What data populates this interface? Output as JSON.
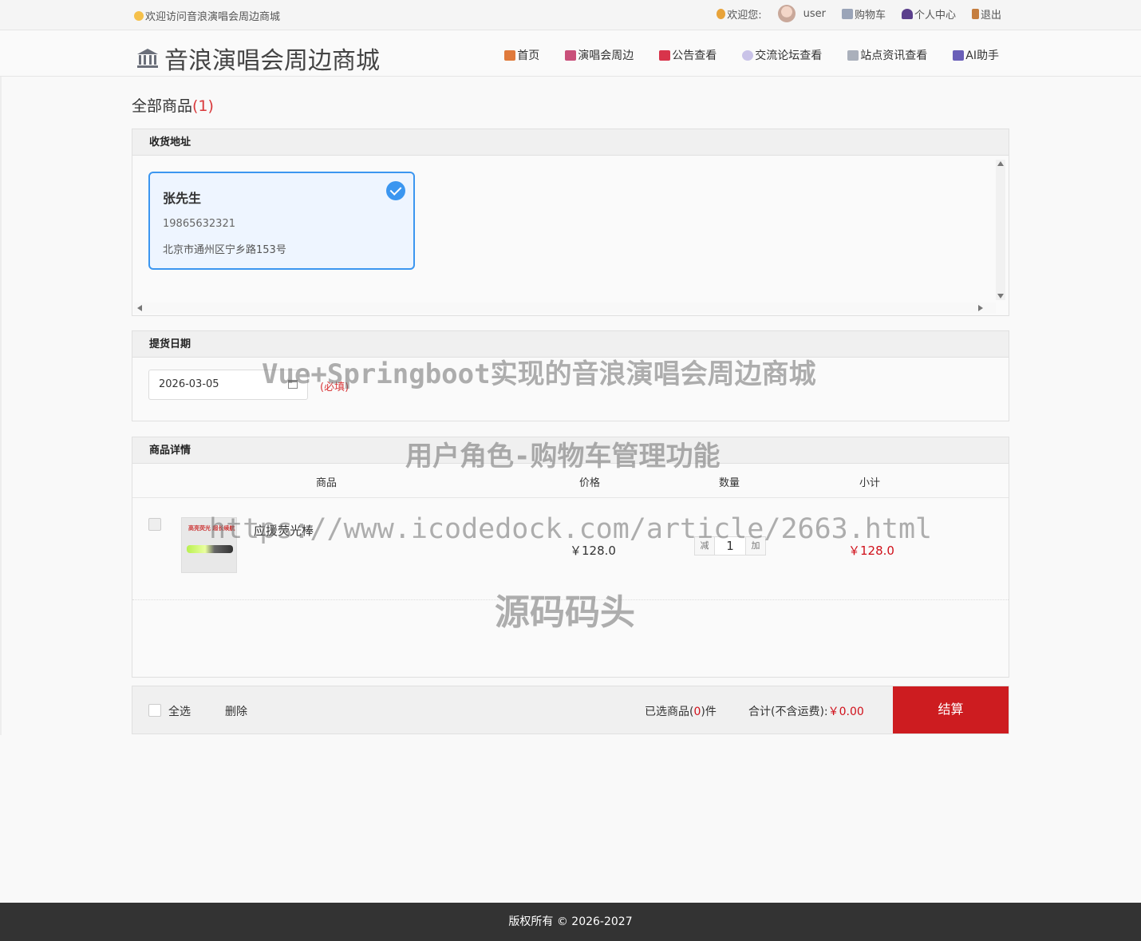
{
  "topbar": {
    "welcome": "欢迎访问音浪演唱会周边商城",
    "greeting": "欢迎您:",
    "username": "user",
    "cart": "购物车",
    "profile": "个人中心",
    "logout": "退出"
  },
  "header": {
    "logo": "音浪演唱会周边商城",
    "nav": [
      "首页",
      "演唱会周边",
      "公告查看",
      "交流论坛查看",
      "站点资讯查看",
      "AI助手"
    ]
  },
  "page": {
    "title": "全部商品",
    "count": "(1)"
  },
  "address": {
    "section_title": "收货地址",
    "name": "张先生",
    "phone": "19865632321",
    "detail": "北京市通州区宁乡路153号"
  },
  "pickup": {
    "section_title": "提货日期",
    "date": "2026-03-05",
    "required": "(必填)"
  },
  "goods": {
    "section_title": "商品详情",
    "headers": [
      "商品",
      "价格",
      "数量",
      "小计"
    ],
    "items": [
      {
        "image_text": "高亮荧光 超长续航",
        "name": "应援荧光棒",
        "price": "￥128.0",
        "quantity": "1",
        "minus": "减",
        "plus": "加",
        "subtotal": "￥128.0"
      }
    ]
  },
  "footer": {
    "select_all": "全选",
    "delete": "删除",
    "selected_prefix": "已选商品(",
    "selected_count": "0",
    "selected_suffix": ")件",
    "total_label": "合计(不含运费):",
    "total_value": "￥0.00",
    "checkout": "结算"
  },
  "watermarks": {
    "line1": "Vue+Springboot实现的音浪演唱会周边商城",
    "line2": "用户角色-购物车管理功能",
    "line3": "https://www.icodedock.com/article/2663.html",
    "line4": "源码码头"
  },
  "copyright": "版权所有 © 2026-2027",
  "colors": {
    "accent_blue": "#3b96f0",
    "price_red": "#d0101a",
    "checkout_red": "#cd1c20"
  }
}
